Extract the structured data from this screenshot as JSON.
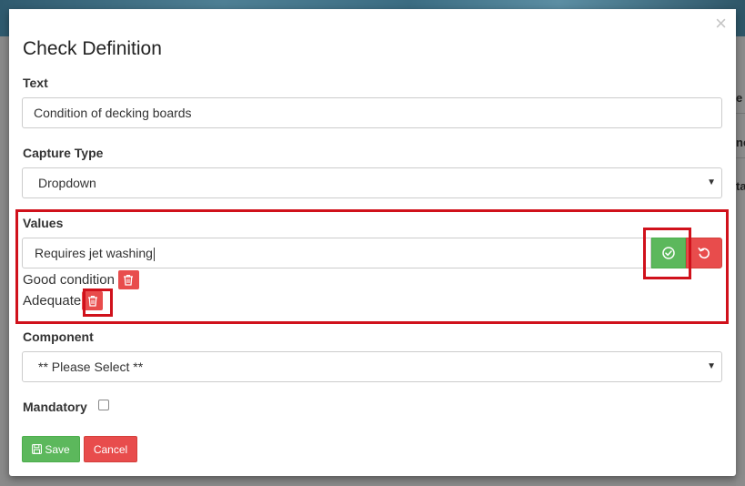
{
  "dialog": {
    "title": "Check Definition",
    "close_glyph": "×"
  },
  "fields": {
    "text": {
      "label": "Text",
      "value": "Condition of decking boards"
    },
    "capture_type": {
      "label": "Capture Type",
      "value": "Dropdown"
    },
    "values": {
      "label": "Values",
      "input_value": "Requires jet washing",
      "items": [
        "Good condition",
        "Adequate"
      ]
    },
    "component": {
      "label": "Component",
      "value": "** Please Select **"
    },
    "mandatory": {
      "label": "Mandatory",
      "checked": false
    }
  },
  "actions": {
    "save_label": "Save",
    "cancel_label": "Cancel"
  },
  "background": {
    "fragments": [
      "e",
      "ne",
      "ta"
    ]
  },
  "icons": {
    "confirm": "check-circle-icon",
    "undo": "undo-icon",
    "trash": "trash-icon",
    "save": "floppy-disk-icon",
    "close": "close-icon",
    "caret": "caret-down-icon"
  },
  "colors": {
    "success": "#5cb85c",
    "danger": "#e84c4c",
    "highlight": "#d0111b"
  }
}
